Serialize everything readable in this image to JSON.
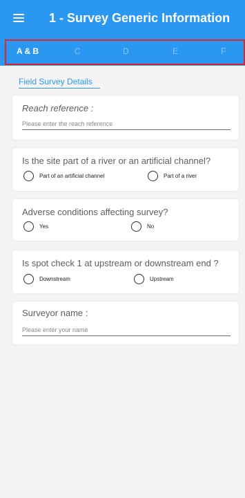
{
  "appbar": {
    "menu_icon": "hamburger-menu-icon",
    "title": "1 - Survey Generic Information",
    "color": "#2a98f0"
  },
  "tabs": [
    {
      "label": "A & B",
      "active": true
    },
    {
      "label": "C",
      "active": false
    },
    {
      "label": "D",
      "active": false
    },
    {
      "label": "E",
      "active": false
    },
    {
      "label": "F",
      "active": false
    }
  ],
  "section": {
    "header": "Field Survey Details"
  },
  "fields": {
    "reach": {
      "label": "Reach reference :",
      "placeholder": "Please enter the reach reference",
      "value": ""
    },
    "site": {
      "question": "Is the site part of a river or an artificial channel?",
      "options": [
        "Part of an artificial channel",
        "Part of a river"
      ]
    },
    "adverse": {
      "question": "Adverse conditions affecting survey?",
      "options": [
        "Yes",
        "No"
      ]
    },
    "spot": {
      "question": "Is spot check 1 at upstream or downstream end ?",
      "options": [
        "Downstream",
        "Upstream"
      ]
    },
    "surveyor": {
      "label": "Surveyor name :",
      "placeholder": "Please enter your name",
      "value": ""
    }
  }
}
